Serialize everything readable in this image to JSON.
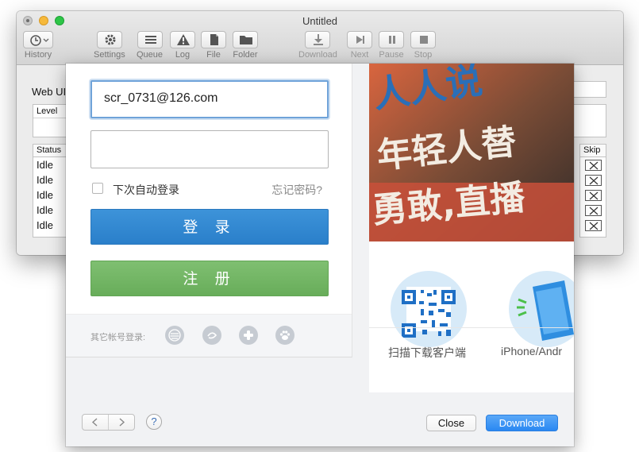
{
  "window": {
    "title": "Untitled"
  },
  "toolbar": {
    "history": "History",
    "settings": "Settings",
    "queue": "Queue",
    "log": "Log",
    "file": "File",
    "folder": "Folder",
    "download": "Download",
    "next": "Next",
    "pause": "Pause",
    "stop": "Stop"
  },
  "main": {
    "web_url_label": "Web UI",
    "level_label": "Level",
    "status_header": "Status",
    "skip_header": "Skip",
    "rows": [
      "Idle",
      "Idle",
      "Idle",
      "Idle",
      "Idle"
    ]
  },
  "login": {
    "username_value": "scr_0731@126.com",
    "password_value": "",
    "auto_login_label": "下次自动登录",
    "forgot_label": "忘记密码?",
    "login_button": "登 录",
    "register_button": "注 册",
    "other_accounts_label": "其它帐号登录:"
  },
  "promo": {
    "banner_line1": "人人说",
    "banner_line2": "年轻人替",
    "banner_line3": "勇敢,直播",
    "qr_caption": "扫描下载客户端",
    "iphone_caption": "iPhone/Andr"
  },
  "footer": {
    "help_label": "?",
    "close_button": "Close",
    "download_button": "Download"
  },
  "colors": {
    "login_blue": "#2f86cf",
    "register_green": "#74b766",
    "download_blue": "#2a88f2",
    "banner_orange": "#c2523a"
  }
}
